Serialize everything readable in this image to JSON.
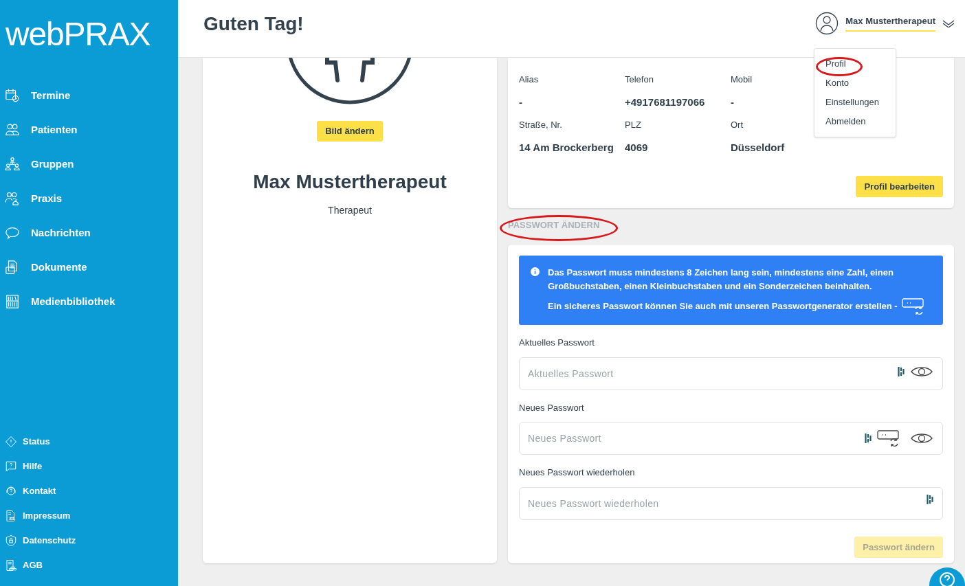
{
  "logo": "webPRAX",
  "nav": [
    {
      "label": "Termine"
    },
    {
      "label": "Patienten"
    },
    {
      "label": "Gruppen"
    },
    {
      "label": "Praxis"
    },
    {
      "label": "Nachrichten"
    },
    {
      "label": "Dokumente"
    },
    {
      "label": "Medienbibliothek"
    }
  ],
  "footer_nav": [
    {
      "label": "Status"
    },
    {
      "label": "Hilfe"
    },
    {
      "label": "Kontakt"
    },
    {
      "label": "Impressum"
    },
    {
      "label": "Datenschutz"
    },
    {
      "label": "AGB"
    }
  ],
  "header": {
    "greeting": "Guten Tag!",
    "user": "Max Mustertherapeut"
  },
  "user_menu": [
    {
      "label": "Profil",
      "highlighted": true
    },
    {
      "label": "Konto",
      "highlighted": false
    },
    {
      "label": "Einstellungen",
      "highlighted": false
    },
    {
      "label": "Abmelden",
      "highlighted": false
    }
  ],
  "profile_card": {
    "button": "Bild ändern",
    "name": "Max Mustertherapeut",
    "role": "Therapeut"
  },
  "details": [
    [
      {
        "label": "Alias",
        "value": "-"
      },
      {
        "label": "Telefon",
        "value": "+4917681197066"
      },
      {
        "label": "Mobil",
        "value": "-"
      }
    ],
    [
      {
        "label": "Straße, Nr.",
        "value": "14 Am Brockerberg"
      },
      {
        "label": "PLZ",
        "value": "4069"
      },
      {
        "label": "Ort",
        "value": "Düsseldorf"
      }
    ]
  ],
  "edit_button": "Profil bearbeiten",
  "password_section": {
    "heading": "PASSWORT ÄNDERN",
    "highlighted": true,
    "info": [
      "Das Passwort muss mindestens 8 Zeichen lang sein, mindestens eine Zahl, einen Großbuchstaben, einen Kleinbuchstaben und ein Sonderzeichen beinhalten.",
      "Ein sicheres Passwort können Sie auch mit unseren Passwortgenerator erstellen -"
    ],
    "fields": [
      {
        "label": "Aktuelles Passwort",
        "placeholder": "Aktuelles Passwort",
        "generator": false,
        "toggle": true
      },
      {
        "label": "Neues Passwort",
        "placeholder": "Neues Passwort",
        "generator": true,
        "toggle": true
      },
      {
        "label": "Neues Passwort wiederholen",
        "placeholder": "Neues Passwort wiederholen",
        "generator": false,
        "toggle": false
      }
    ],
    "submit": {
      "label": "Passwort ändern",
      "disabled": true
    }
  }
}
